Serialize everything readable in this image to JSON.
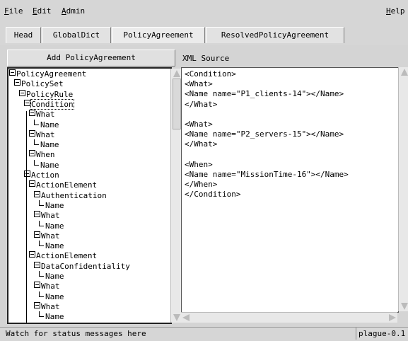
{
  "menu": {
    "file": "File",
    "file_rest": "ile",
    "file_key": "F",
    "edit": "Edit",
    "edit_key": "E",
    "edit_rest": "dit",
    "admin": "Admin",
    "admin_key": "A",
    "admin_rest": "dmin",
    "help": "Help",
    "help_key": "H",
    "help_rest": "elp"
  },
  "tabs": [
    "Head",
    "GlobalDict",
    "PolicyAgreement",
    "ResolvedPolicyAgreement"
  ],
  "add_button": "Add PolicyAgreement",
  "xml_label": "XML Source",
  "tree": [
    {
      "label": "PolicyAgreement",
      "type": "branch"
    },
    {
      "label": "PolicySet",
      "type": "branch"
    },
    {
      "label": "PolicyRule",
      "type": "branch"
    },
    {
      "label": "Condition",
      "type": "branch",
      "selected": true
    },
    {
      "label": "What",
      "type": "branch"
    },
    {
      "label": "Name",
      "type": "leaf"
    },
    {
      "label": "What",
      "type": "branch"
    },
    {
      "label": "Name",
      "type": "leaf"
    },
    {
      "label": "When",
      "type": "branch"
    },
    {
      "label": "Name",
      "type": "leaf"
    },
    {
      "label": "Action",
      "type": "branch"
    },
    {
      "label": "ActionElement",
      "type": "branch"
    },
    {
      "label": "Authentication",
      "type": "branch"
    },
    {
      "label": "Name",
      "type": "leaf"
    },
    {
      "label": "What",
      "type": "branch"
    },
    {
      "label": "Name",
      "type": "leaf"
    },
    {
      "label": "What",
      "type": "branch"
    },
    {
      "label": "Name",
      "type": "leaf"
    },
    {
      "label": "ActionElement",
      "type": "branch"
    },
    {
      "label": "DataConfidentiality",
      "type": "branch"
    },
    {
      "label": "Name",
      "type": "leaf"
    },
    {
      "label": "What",
      "type": "branch"
    },
    {
      "label": "Name",
      "type": "leaf"
    },
    {
      "label": "What",
      "type": "branch"
    },
    {
      "label": "Name",
      "type": "leaf"
    }
  ],
  "xml_lines": [
    "<Condition>",
    "<What>",
    "<Name name=\"P1_clients-14\"></Name>",
    "</What>",
    "",
    "<What>",
    "<Name name=\"P2_servers-15\"></Name>",
    "</What>",
    "",
    "<When>",
    "<Name name=\"MissionTime-16\"></Name>",
    "</When>",
    "</Condition>"
  ],
  "status": {
    "message": "Watch for status messages here",
    "host": "plague-0.1"
  }
}
